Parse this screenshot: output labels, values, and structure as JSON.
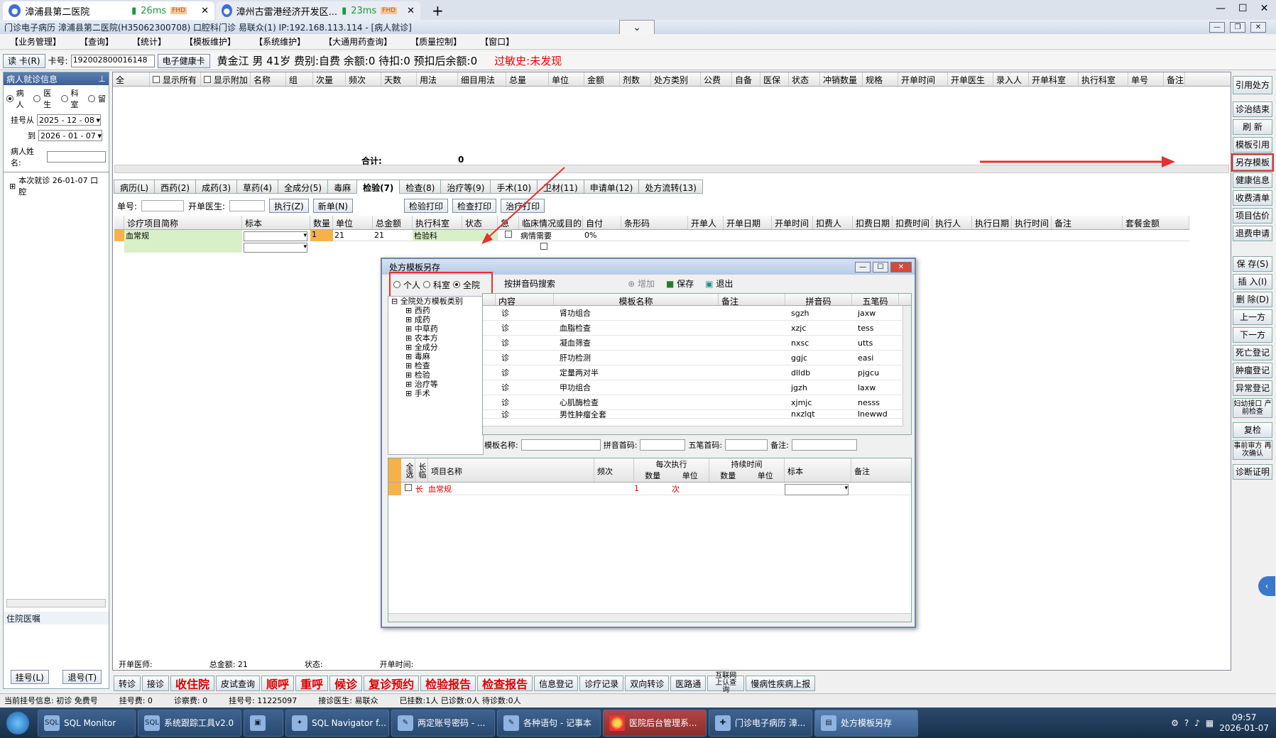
{
  "browser": {
    "tab1_title": "漳浦县第二医院",
    "tab1_ms": "26ms",
    "tab2_title": "漳州古雷港经济开发区...",
    "tab2_ms": "23ms",
    "fhd": "FHD",
    "new_tab": "+",
    "collapse": "⌄"
  },
  "app": {
    "title": "门诊电子病历  漳浦县第二医院(H35062300708)  口腔科门诊  易联众(1) IP:192.168.113.114 - [病人就诊]"
  },
  "menu": [
    "【业务管理】",
    "【查询】",
    "【统计】",
    "【模板维护】",
    "【系统维护】",
    "【大通用药查询】",
    "【质量控制】",
    "【窗口】"
  ],
  "patient_bar": {
    "read_card": "读 卡(R)",
    "card_label": "卡号:",
    "card_no": "192002800016148",
    "health_card": "电子健康卡",
    "info": "黄金江  男  41岁  费别:自费  余额:0  待扣:0  预扣后余额:0",
    "allergy": "过敏史:未发现"
  },
  "left": {
    "title": "病人就诊信息",
    "pin": "⊥",
    "radio_patient": "病人",
    "radio_doctor": "医生",
    "radio_dept": "科室",
    "radio_stay": "留",
    "reg_from": "挂号从",
    "date_from": "2025 - 12 - 08",
    "reg_to": "到",
    "date_to": "2026 - 01 - 07",
    "name_label": "病人姓名:",
    "tree_item": "本次就诊  26-01-07  口腔",
    "inpatient": "住院医嘱",
    "reg_btn": "挂号(L)",
    "unreg_btn": "退号(T)"
  },
  "rx_grid": {
    "all": "全",
    "show_all": "显示所有",
    "show_extra": "显示附加",
    "columns": [
      "名称",
      "组",
      "次量",
      "频次",
      "天数",
      "用法",
      "细目用法",
      "总量",
      "单位",
      "金额",
      "剂数",
      "处方类别",
      "公费",
      "自备",
      "医保",
      "状态",
      "冲销数量",
      "规格",
      "开单时间",
      "开单医生",
      "录入人",
      "开单科室",
      "执行科室",
      "单号",
      "备注"
    ],
    "total_label": "合计:",
    "total_value": "0"
  },
  "subtabs": [
    "病历(L)",
    "西药(2)",
    "成药(3)",
    "草药(4)",
    "全成分(5)",
    "毒麻",
    "检验(7)",
    "检查(8)",
    "治疗等(9)",
    "手术(10)",
    "卫材(11)",
    "申请单(12)",
    "处方流转(13)"
  ],
  "lab": {
    "order_no": "单号:",
    "doctor": "开单医生:",
    "exec_btn": "执行(Z)",
    "new_btn": "新单(N)",
    "print_lab": "检验打印",
    "print_exam": "检查打印",
    "print_treat": "治疗打印",
    "columns": [
      "诊疗项目简称",
      "标本",
      "数量",
      "单位",
      "总金额",
      "执行科室",
      "状态",
      "急",
      "临床情况或目的",
      "自付",
      "条形码",
      "开单人",
      "开单日期",
      "开单时间",
      "扣费人",
      "扣费日期",
      "扣费时间",
      "执行人",
      "执行日期",
      "执行时间",
      "备注",
      "套餐金额"
    ],
    "row": {
      "name": "血常规",
      "qty": "1",
      "price": "21",
      "total": "21",
      "dept": "检验科",
      "purpose": "病情需要",
      "self": "0%"
    }
  },
  "right_toolbar": [
    "引用处方",
    "诊治结束",
    "刷 新",
    "模板引用",
    "另存模板",
    "健康信息",
    "收费清单",
    "项目估价",
    "退费申请",
    "保 存(S)",
    "插 入(I)",
    "删 除(D)",
    "上一方",
    "下一方",
    "死亡登记",
    "肿瘤登记",
    "异常登记",
    "妇幼接口 产前检查",
    "复检",
    "事前审方 再次确认",
    "诊断证明"
  ],
  "dialog": {
    "title": "处方模板另存",
    "scope_personal": "个人",
    "scope_dept": "科室",
    "scope_hospital": "全院",
    "search": "按拼音码搜索",
    "add": "增加",
    "save": "保存",
    "exit": "退出",
    "tree_root": "全院处方模板类别",
    "tree_items": [
      "西药",
      "成药",
      "中草药",
      "农本方",
      "全成分",
      "毒麻",
      "检查",
      "检验",
      "治疗等",
      "手术"
    ],
    "tpl_columns": [
      "内容",
      "模板名称",
      "备注",
      "拼音码",
      "五笔码"
    ],
    "templates": [
      {
        "type": "诊",
        "name": "肾功组合",
        "py": "sgzh",
        "wb": "jaxw"
      },
      {
        "type": "诊",
        "name": "血脂检查",
        "py": "xzjc",
        "wb": "tess"
      },
      {
        "type": "诊",
        "name": "凝血筛查",
        "py": "nxsc",
        "wb": "utts"
      },
      {
        "type": "诊",
        "name": "肝功检测",
        "py": "ggjc",
        "wb": "easi"
      },
      {
        "type": "诊",
        "name": "定量两对半",
        "py": "dlldb",
        "wb": "pjgcu"
      },
      {
        "type": "诊",
        "name": "甲功组合",
        "py": "jgzh",
        "wb": "laxw"
      },
      {
        "type": "诊",
        "name": "心肌酶检查",
        "py": "xjmjc",
        "wb": "nesss"
      },
      {
        "type": "诊",
        "name": "男性肿瘤全套",
        "py": "nxzlqt",
        "wb": "lnewwd"
      }
    ],
    "form_name": "模板名称:",
    "form_py": "拼音首码:",
    "form_wb": "五笔首码:",
    "form_note": "备注:",
    "items_cols": {
      "all": "全选",
      "long": "长临",
      "name": "项目名称",
      "freq": "频次",
      "per_exec": "每次执行",
      "qty": "数量",
      "unit": "单位",
      "duration": "持续时间",
      "dqty": "数量",
      "dunit": "单位",
      "specimen": "标本",
      "note": "备注"
    },
    "item_row": {
      "long": "长",
      "name": "血常规",
      "qty": "1",
      "unit": "次"
    }
  },
  "bottom_info": {
    "doctor": "开单医师:",
    "total": "总金额: 21",
    "status": "状态:",
    "time": "开单时间:"
  },
  "bottom_buttons": [
    "转诊",
    "接诊",
    "收住院",
    "皮试查询",
    "顺呼",
    "重呼",
    "候诊",
    "复诊预约",
    "检验报告",
    "检查报告",
    "信息登记",
    "诊疗记录",
    "双向转诊",
    "医路通",
    "互联网上认查询",
    "慢病性疾病上报"
  ],
  "status_bar": {
    "reg": "当前挂号信息: 初诊 免费号",
    "fee": "挂号费: 0",
    "diag_fee": "诊察费: 0",
    "reg_no": "挂号号: 11225097",
    "doctor": "接诊医生: 易联众",
    "counts": "已挂数:1人 已诊数:0人 待诊数:0人"
  },
  "taskbar": {
    "items": [
      "SQL Monitor",
      "系统跟踪工具v2.0",
      "",
      "SQL Navigator f...",
      "两定账号密码 - ...",
      "各种语句 - 记事本",
      "医院后台管理系...",
      "门诊电子病历 漳...",
      "处方模板另存"
    ],
    "time": "09:57",
    "date": "2026-01-07"
  },
  "colors": {
    "accent": "#3d5f92",
    "red": "#e00000",
    "annotation": "#e53030"
  }
}
